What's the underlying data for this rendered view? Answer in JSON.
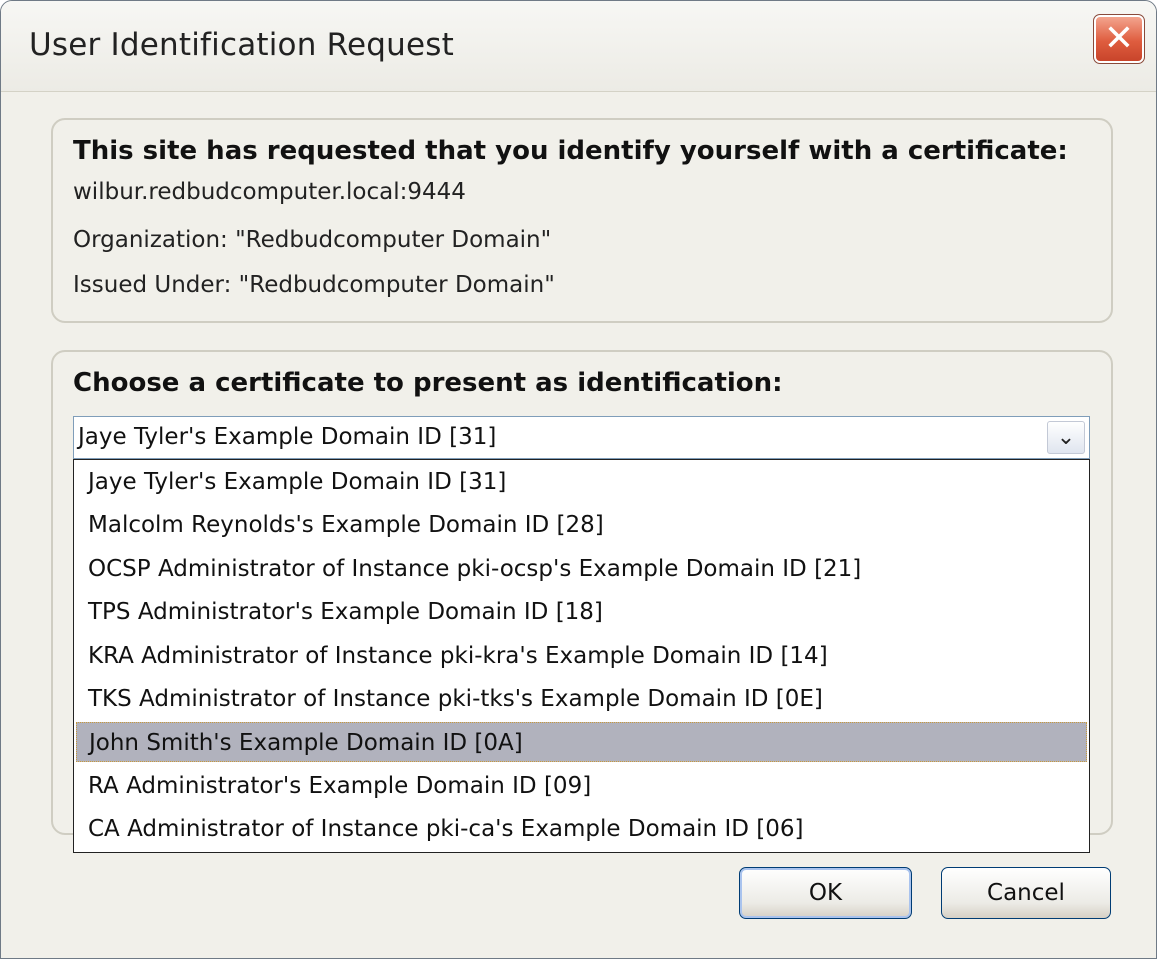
{
  "window": {
    "title": "User Identification Request",
    "close_glyph": "✕"
  },
  "info": {
    "heading": "This site has requested that you identify yourself with a certificate:",
    "host": "wilbur.redbudcomputer.local:9444",
    "organization": "Organization: \"Redbudcomputer Domain\"",
    "issued_under": "Issued Under: \"Redbudcomputer Domain\""
  },
  "chooser": {
    "heading": "Choose a certificate to present as identification:",
    "selected_value": "Jaye Tyler's Example Domain ID [31]",
    "dropdown_glyph": "⌄",
    "options": [
      {
        "label": "Jaye Tyler's Example Domain ID [31]",
        "highlighted": false
      },
      {
        "label": "Malcolm Reynolds's Example Domain ID [28]",
        "highlighted": false
      },
      {
        "label": "OCSP Administrator of Instance pki-ocsp's Example Domain ID [21]",
        "highlighted": false
      },
      {
        "label": "TPS Administrator's Example Domain ID [18]",
        "highlighted": false
      },
      {
        "label": "KRA Administrator of Instance pki-kra's Example Domain ID [14]",
        "highlighted": false
      },
      {
        "label": "TKS Administrator of Instance pki-tks's Example Domain ID [0E]",
        "highlighted": false
      },
      {
        "label": "John Smith's Example Domain ID [0A]",
        "highlighted": true
      },
      {
        "label": "RA Administrator's Example Domain ID [09]",
        "highlighted": false
      },
      {
        "label": "CA Administrator of Instance pki-ca's Example Domain ID [06]",
        "highlighted": false
      }
    ]
  },
  "buttons": {
    "ok_label": "OK",
    "cancel_label": "Cancel"
  },
  "colors": {
    "dialog_bg": "#f1f0ea",
    "highlight_bg": "#b1b2bd",
    "close_button": "#df5d3f"
  }
}
